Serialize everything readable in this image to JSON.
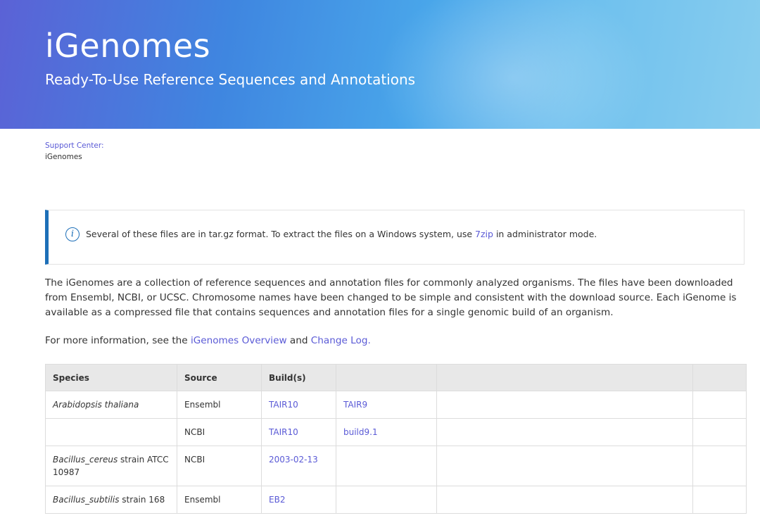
{
  "hero": {
    "title": "iGenomes",
    "subtitle": "Ready-To-Use Reference Sequences and Annotations"
  },
  "breadcrumb": {
    "parent": "Support Center:",
    "current": "iGenomes"
  },
  "notice": {
    "icon": "info-icon",
    "text_before": "Several of these files are in tar.gz format. To extract the files on a Windows system, use ",
    "link": "7zip",
    "text_after": " in administrator mode."
  },
  "intro": "The iGenomes are a collection of reference sequences and annotation files for commonly analyzed organisms. The files have been downloaded from Ensembl, NCBI, or UCSC. Chromosome names have been changed to be simple and consistent with the download source. Each iGenome is available as a compressed file that contains sequences and annotation files for a single genomic build of an organism.",
  "more_info": {
    "prefix": "For more information, see the ",
    "link1": "iGenomes Overview",
    "middle": " and ",
    "link2": "Change Log."
  },
  "table": {
    "headers": [
      "Species",
      "Source",
      "Build(s)",
      "",
      "",
      ""
    ],
    "rows": [
      {
        "species_italic": "Arabidopsis thaliana",
        "species_plain": "",
        "source": "Ensembl",
        "builds": [
          "TAIR10",
          "TAIR9"
        ]
      },
      {
        "species_italic": "",
        "species_plain": "",
        "source": "NCBI",
        "builds": [
          "TAIR10",
          "build9.1"
        ]
      },
      {
        "species_italic": "Bacillus_cereus",
        "species_plain": " strain ATCC 10987",
        "source": "NCBI",
        "builds": [
          "2003-02-13",
          ""
        ]
      },
      {
        "species_italic": "Bacillus_subtilis",
        "species_plain": " strain 168",
        "source": "Ensembl",
        "builds": [
          "EB2",
          ""
        ]
      }
    ]
  },
  "colors": {
    "link": "#5a5ad6",
    "notice_accent": "#1d6fb8",
    "header_bg": "#e8e8e8"
  }
}
